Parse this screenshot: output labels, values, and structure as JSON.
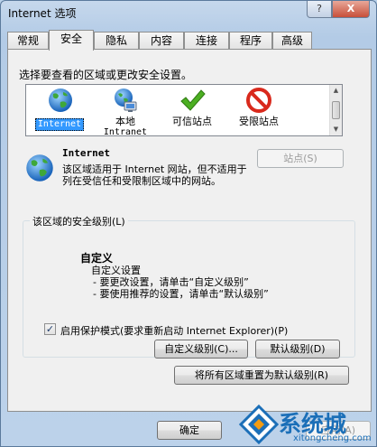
{
  "window": {
    "title": "Internet 选项",
    "help_label": "?",
    "close_label": "X"
  },
  "tabs": [
    {
      "label": "常规"
    },
    {
      "label": "安全"
    },
    {
      "label": "隐私"
    },
    {
      "label": "内容"
    },
    {
      "label": "连接"
    },
    {
      "label": "程序"
    },
    {
      "label": "高级"
    }
  ],
  "active_tab": "安全",
  "security": {
    "prompt": "选择要查看的区域或更改安全设置。",
    "zones": [
      {
        "line1": "Internet",
        "line2": "",
        "icon": "globe-icon",
        "selected": true
      },
      {
        "line1": "本地",
        "line2": "Intranet",
        "icon": "intranet-globe-icon",
        "selected": false
      },
      {
        "line1": "可信站点",
        "line2": "",
        "icon": "checkmark-icon",
        "selected": false
      },
      {
        "line1": "受限站点",
        "line2": "",
        "icon": "restricted-icon",
        "selected": false
      }
    ],
    "zone_title": "Internet",
    "zone_desc": "该区域适用于 Internet 网站，但不适用于列在受信任和受限制区域中的网站。",
    "sites_button": "站点(S)",
    "level_group_title": "该区域的安全级别(L)",
    "level_title": "自定义",
    "level_lines": [
      "自定义设置",
      "- 要更改设置，请单击“自定义级别”",
      "- 要使用推荐的设置，请单击“默认级别”"
    ],
    "protected_mode_label": "启用保护模式(要求重新启动 Internet Explorer)(P)",
    "protected_mode_checked": true,
    "custom_level_button": "自定义级别(C)...",
    "default_level_button": "默认级别(D)",
    "reset_all_button": "将所有区域重置为默认级别(R)"
  },
  "footer": {
    "ok_button": "确定",
    "apply_button": "应用(A)"
  },
  "watermark": {
    "text": "系统城",
    "url": "xitongcheng.com"
  },
  "colors": {
    "selection": "#3399ff",
    "check_green": "#4caf22",
    "restricted_red": "#d9291c",
    "watermark_blue": "#1b6fb8"
  }
}
